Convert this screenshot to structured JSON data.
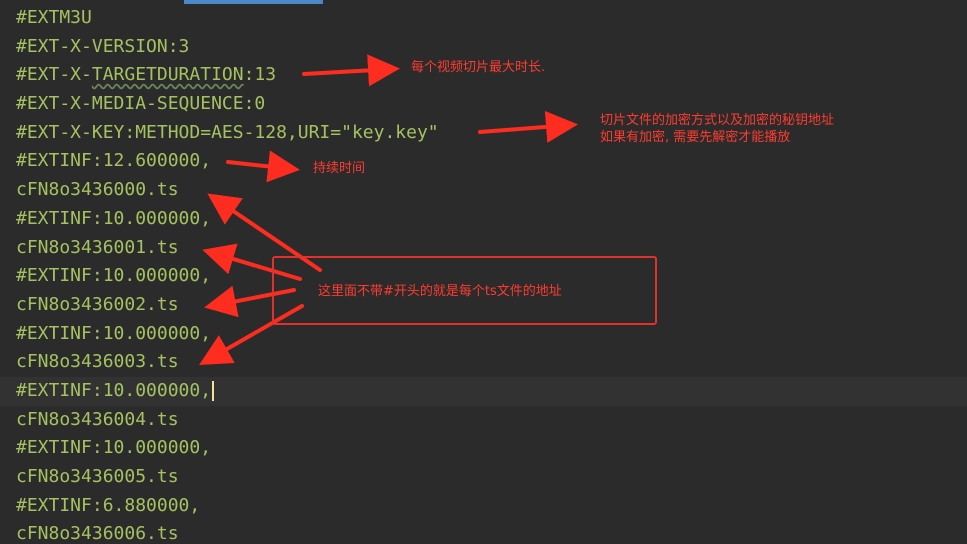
{
  "editor": {
    "lines": [
      {
        "text": "#EXTM3U"
      },
      {
        "text": "#EXT-X-VERSION:3"
      },
      {
        "prefix": "#EXT-X-",
        "squiggle": "TARGETDURATION",
        "suffix": ":13"
      },
      {
        "text": "#EXT-X-MEDIA-SEQUENCE:0"
      },
      {
        "text": "#EXT-X-KEY:METHOD=AES-128,URI=\"key.key\""
      },
      {
        "text": "#EXTINF:12.600000,"
      },
      {
        "text": "cFN8o3436000.ts"
      },
      {
        "text": "#EXTINF:10.000000,"
      },
      {
        "text": "cFN8o3436001.ts"
      },
      {
        "text": "#EXTINF:10.000000,"
      },
      {
        "text": "cFN8o3436002.ts"
      },
      {
        "text": "#EXTINF:10.000000,"
      },
      {
        "text": "cFN8o3436003.ts"
      },
      {
        "text": "#EXTINF:10.000000,"
      },
      {
        "text": "cFN8o3436004.ts"
      },
      {
        "text": "#EXTINF:10.000000,"
      },
      {
        "text": "cFN8o3436005.ts"
      },
      {
        "text": "#EXTINF:6.880000,"
      },
      {
        "text": "cFN8o3436006.ts"
      }
    ],
    "current_line_index": 13
  },
  "annotations": {
    "target_duration_note": "每个视频切片最大时长.",
    "key_note_line1": "切片文件的加密方式以及加密的秘钥地址",
    "key_note_line2": "如果有加密, 需要先解密才能播放",
    "duration_note": "持续时间",
    "ts_note": "这里面不带#开头的就是每个ts文件的地址"
  },
  "colors": {
    "background": "#2b2b2b",
    "text": "#a9b7c6",
    "annotation": "#ff3b30",
    "tab_indicator": "#4a88c7"
  }
}
